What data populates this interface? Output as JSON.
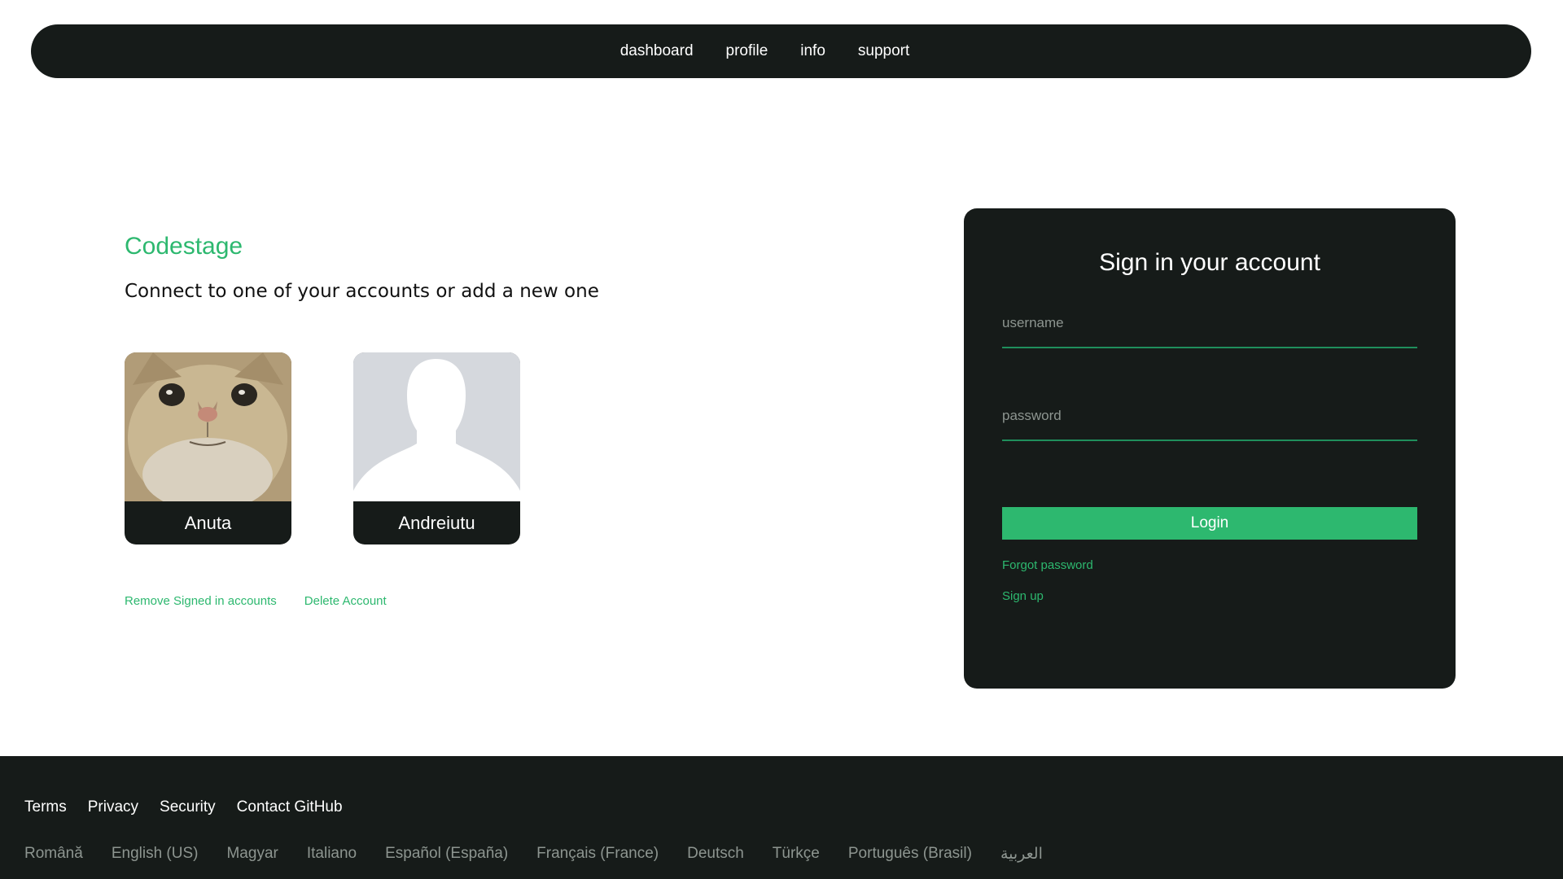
{
  "nav": {
    "items": [
      "dashboard",
      "profile",
      "info",
      "support"
    ]
  },
  "left": {
    "brand": "Codestage",
    "subtitle": "Connect to one of your accounts or add a new one",
    "accounts": [
      {
        "name": "Anuta",
        "avatar": "cat-photo"
      },
      {
        "name": "Andreiutu",
        "avatar": "default-silhouette"
      }
    ],
    "links": {
      "remove": "Remove Signed in accounts",
      "delete": "Delete Account"
    }
  },
  "signin": {
    "title": "Sign in your account",
    "username_placeholder": "username",
    "password_placeholder": "password",
    "login_label": "Login",
    "forgot_label": "Forgot password",
    "signup_label": "Sign up"
  },
  "footer": {
    "links": [
      "Terms",
      "Privacy",
      "Security",
      "Contact GitHub"
    ],
    "languages": [
      "Română",
      "English (US)",
      "Magyar",
      "Italiano",
      "Español (España)",
      "Français (France)",
      "Deutsch",
      "Türkçe",
      "Português (Brasil)",
      "العربية"
    ]
  },
  "colors": {
    "accent": "#2db86f",
    "dark": "#161b19",
    "muted": "#8d9590"
  }
}
